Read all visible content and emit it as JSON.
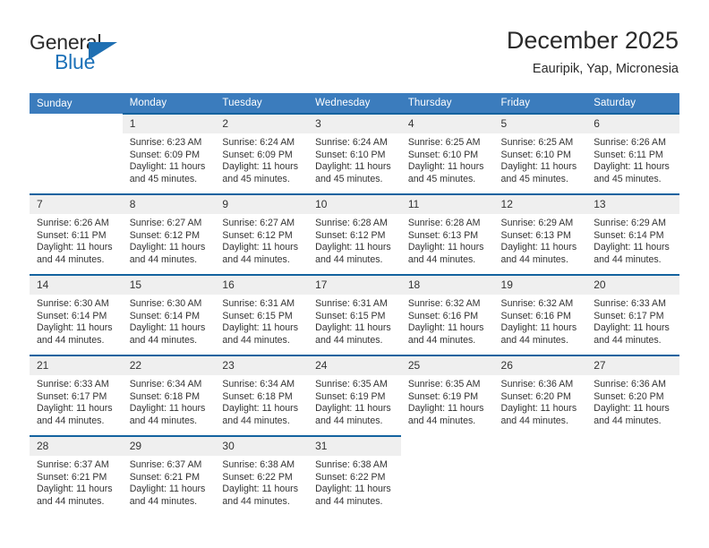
{
  "brand": {
    "name_top": "General",
    "name_bottom": "Blue",
    "triangle_color": "#1f6fb2",
    "blue_color": "#1c71b8"
  },
  "header": {
    "title": "December 2025",
    "subtitle": "Eauripik, Yap, Micronesia"
  },
  "theme": {
    "header_row_bg": "#3b7cbd",
    "row_separator": "#14639f",
    "daynum_bg": "#efefef",
    "text": "#333333"
  },
  "calendar": {
    "weekday_headers": [
      "Sunday",
      "Monday",
      "Tuesday",
      "Wednesday",
      "Thursday",
      "Friday",
      "Saturday"
    ],
    "weeks": [
      [
        {
          "day": "",
          "sunrise": "",
          "sunset": "",
          "daylight_line1": "",
          "daylight_line2": ""
        },
        {
          "day": "1",
          "sunrise": "Sunrise: 6:23 AM",
          "sunset": "Sunset: 6:09 PM",
          "daylight_line1": "Daylight: 11 hours",
          "daylight_line2": "and 45 minutes."
        },
        {
          "day": "2",
          "sunrise": "Sunrise: 6:24 AM",
          "sunset": "Sunset: 6:09 PM",
          "daylight_line1": "Daylight: 11 hours",
          "daylight_line2": "and 45 minutes."
        },
        {
          "day": "3",
          "sunrise": "Sunrise: 6:24 AM",
          "sunset": "Sunset: 6:10 PM",
          "daylight_line1": "Daylight: 11 hours",
          "daylight_line2": "and 45 minutes."
        },
        {
          "day": "4",
          "sunrise": "Sunrise: 6:25 AM",
          "sunset": "Sunset: 6:10 PM",
          "daylight_line1": "Daylight: 11 hours",
          "daylight_line2": "and 45 minutes."
        },
        {
          "day": "5",
          "sunrise": "Sunrise: 6:25 AM",
          "sunset": "Sunset: 6:10 PM",
          "daylight_line1": "Daylight: 11 hours",
          "daylight_line2": "and 45 minutes."
        },
        {
          "day": "6",
          "sunrise": "Sunrise: 6:26 AM",
          "sunset": "Sunset: 6:11 PM",
          "daylight_line1": "Daylight: 11 hours",
          "daylight_line2": "and 45 minutes."
        }
      ],
      [
        {
          "day": "7",
          "sunrise": "Sunrise: 6:26 AM",
          "sunset": "Sunset: 6:11 PM",
          "daylight_line1": "Daylight: 11 hours",
          "daylight_line2": "and 44 minutes."
        },
        {
          "day": "8",
          "sunrise": "Sunrise: 6:27 AM",
          "sunset": "Sunset: 6:12 PM",
          "daylight_line1": "Daylight: 11 hours",
          "daylight_line2": "and 44 minutes."
        },
        {
          "day": "9",
          "sunrise": "Sunrise: 6:27 AM",
          "sunset": "Sunset: 6:12 PM",
          "daylight_line1": "Daylight: 11 hours",
          "daylight_line2": "and 44 minutes."
        },
        {
          "day": "10",
          "sunrise": "Sunrise: 6:28 AM",
          "sunset": "Sunset: 6:12 PM",
          "daylight_line1": "Daylight: 11 hours",
          "daylight_line2": "and 44 minutes."
        },
        {
          "day": "11",
          "sunrise": "Sunrise: 6:28 AM",
          "sunset": "Sunset: 6:13 PM",
          "daylight_line1": "Daylight: 11 hours",
          "daylight_line2": "and 44 minutes."
        },
        {
          "day": "12",
          "sunrise": "Sunrise: 6:29 AM",
          "sunset": "Sunset: 6:13 PM",
          "daylight_line1": "Daylight: 11 hours",
          "daylight_line2": "and 44 minutes."
        },
        {
          "day": "13",
          "sunrise": "Sunrise: 6:29 AM",
          "sunset": "Sunset: 6:14 PM",
          "daylight_line1": "Daylight: 11 hours",
          "daylight_line2": "and 44 minutes."
        }
      ],
      [
        {
          "day": "14",
          "sunrise": "Sunrise: 6:30 AM",
          "sunset": "Sunset: 6:14 PM",
          "daylight_line1": "Daylight: 11 hours",
          "daylight_line2": "and 44 minutes."
        },
        {
          "day": "15",
          "sunrise": "Sunrise: 6:30 AM",
          "sunset": "Sunset: 6:14 PM",
          "daylight_line1": "Daylight: 11 hours",
          "daylight_line2": "and 44 minutes."
        },
        {
          "day": "16",
          "sunrise": "Sunrise: 6:31 AM",
          "sunset": "Sunset: 6:15 PM",
          "daylight_line1": "Daylight: 11 hours",
          "daylight_line2": "and 44 minutes."
        },
        {
          "day": "17",
          "sunrise": "Sunrise: 6:31 AM",
          "sunset": "Sunset: 6:15 PM",
          "daylight_line1": "Daylight: 11 hours",
          "daylight_line2": "and 44 minutes."
        },
        {
          "day": "18",
          "sunrise": "Sunrise: 6:32 AM",
          "sunset": "Sunset: 6:16 PM",
          "daylight_line1": "Daylight: 11 hours",
          "daylight_line2": "and 44 minutes."
        },
        {
          "day": "19",
          "sunrise": "Sunrise: 6:32 AM",
          "sunset": "Sunset: 6:16 PM",
          "daylight_line1": "Daylight: 11 hours",
          "daylight_line2": "and 44 minutes."
        },
        {
          "day": "20",
          "sunrise": "Sunrise: 6:33 AM",
          "sunset": "Sunset: 6:17 PM",
          "daylight_line1": "Daylight: 11 hours",
          "daylight_line2": "and 44 minutes."
        }
      ],
      [
        {
          "day": "21",
          "sunrise": "Sunrise: 6:33 AM",
          "sunset": "Sunset: 6:17 PM",
          "daylight_line1": "Daylight: 11 hours",
          "daylight_line2": "and 44 minutes."
        },
        {
          "day": "22",
          "sunrise": "Sunrise: 6:34 AM",
          "sunset": "Sunset: 6:18 PM",
          "daylight_line1": "Daylight: 11 hours",
          "daylight_line2": "and 44 minutes."
        },
        {
          "day": "23",
          "sunrise": "Sunrise: 6:34 AM",
          "sunset": "Sunset: 6:18 PM",
          "daylight_line1": "Daylight: 11 hours",
          "daylight_line2": "and 44 minutes."
        },
        {
          "day": "24",
          "sunrise": "Sunrise: 6:35 AM",
          "sunset": "Sunset: 6:19 PM",
          "daylight_line1": "Daylight: 11 hours",
          "daylight_line2": "and 44 minutes."
        },
        {
          "day": "25",
          "sunrise": "Sunrise: 6:35 AM",
          "sunset": "Sunset: 6:19 PM",
          "daylight_line1": "Daylight: 11 hours",
          "daylight_line2": "and 44 minutes."
        },
        {
          "day": "26",
          "sunrise": "Sunrise: 6:36 AM",
          "sunset": "Sunset: 6:20 PM",
          "daylight_line1": "Daylight: 11 hours",
          "daylight_line2": "and 44 minutes."
        },
        {
          "day": "27",
          "sunrise": "Sunrise: 6:36 AM",
          "sunset": "Sunset: 6:20 PM",
          "daylight_line1": "Daylight: 11 hours",
          "daylight_line2": "and 44 minutes."
        }
      ],
      [
        {
          "day": "28",
          "sunrise": "Sunrise: 6:37 AM",
          "sunset": "Sunset: 6:21 PM",
          "daylight_line1": "Daylight: 11 hours",
          "daylight_line2": "and 44 minutes."
        },
        {
          "day": "29",
          "sunrise": "Sunrise: 6:37 AM",
          "sunset": "Sunset: 6:21 PM",
          "daylight_line1": "Daylight: 11 hours",
          "daylight_line2": "and 44 minutes."
        },
        {
          "day": "30",
          "sunrise": "Sunrise: 6:38 AM",
          "sunset": "Sunset: 6:22 PM",
          "daylight_line1": "Daylight: 11 hours",
          "daylight_line2": "and 44 minutes."
        },
        {
          "day": "31",
          "sunrise": "Sunrise: 6:38 AM",
          "sunset": "Sunset: 6:22 PM",
          "daylight_line1": "Daylight: 11 hours",
          "daylight_line2": "and 44 minutes."
        },
        {
          "day": "",
          "sunrise": "",
          "sunset": "",
          "daylight_line1": "",
          "daylight_line2": ""
        },
        {
          "day": "",
          "sunrise": "",
          "sunset": "",
          "daylight_line1": "",
          "daylight_line2": ""
        },
        {
          "day": "",
          "sunrise": "",
          "sunset": "",
          "daylight_line1": "",
          "daylight_line2": ""
        }
      ]
    ]
  }
}
